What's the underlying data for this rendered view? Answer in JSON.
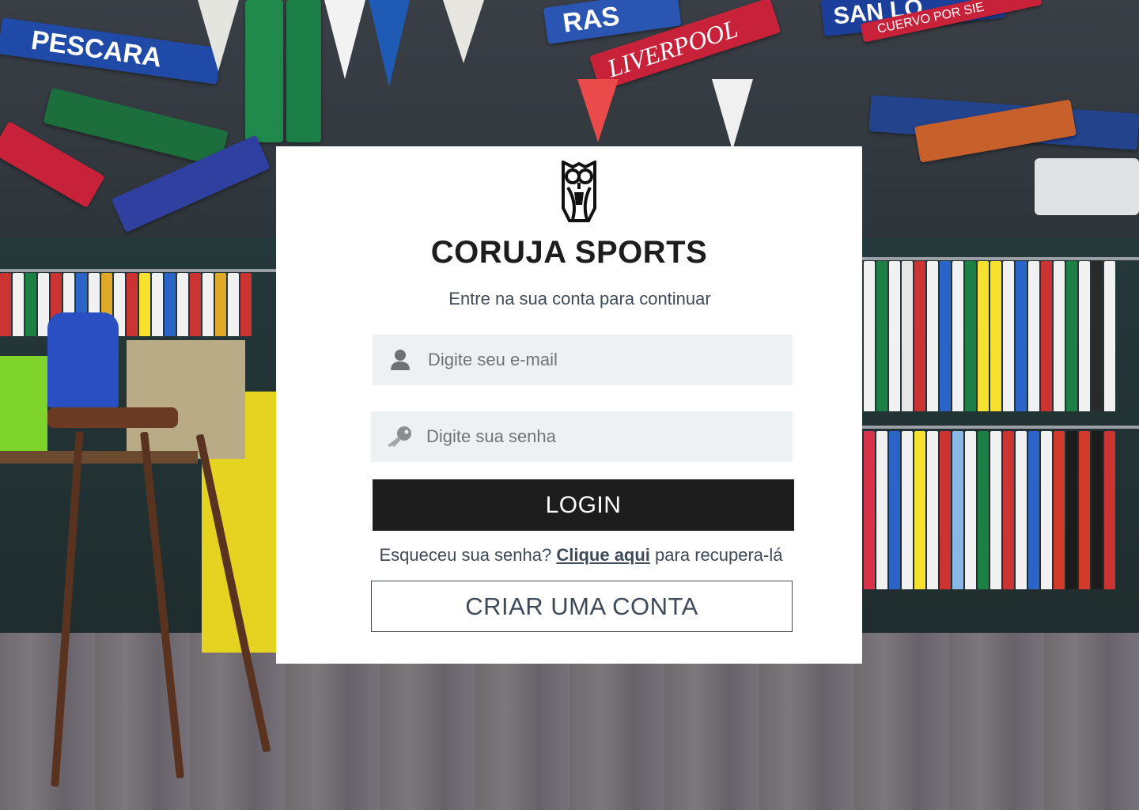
{
  "brand": {
    "name": "CORUJA SPORTS",
    "logo_icon": "owl-logo-icon"
  },
  "login": {
    "subtitle": "Entre na sua conta para continuar",
    "email_placeholder": "Digite seu e-mail",
    "email_icon": "user-icon",
    "password_placeholder": "Digite sua senha",
    "password_icon": "key-icon",
    "login_label": "LOGIN",
    "forgot_prefix": "Esqueceu sua senha?",
    "forgot_link": "Clique aqui",
    "forgot_suffix": "para recupera-lá",
    "create_account_label": "CRIAR UMA CONTA"
  },
  "background": {
    "scarf_texts": [
      "PESCARA",
      "RAS",
      "LIVERPOOL",
      "SAN LO",
      "CUERVO POR SIE"
    ]
  },
  "colors": {
    "primary_button": "#1d1d1d",
    "text_muted": "#3f4a58",
    "input_bg": "#edf1f4",
    "card_bg": "#ffffff"
  }
}
